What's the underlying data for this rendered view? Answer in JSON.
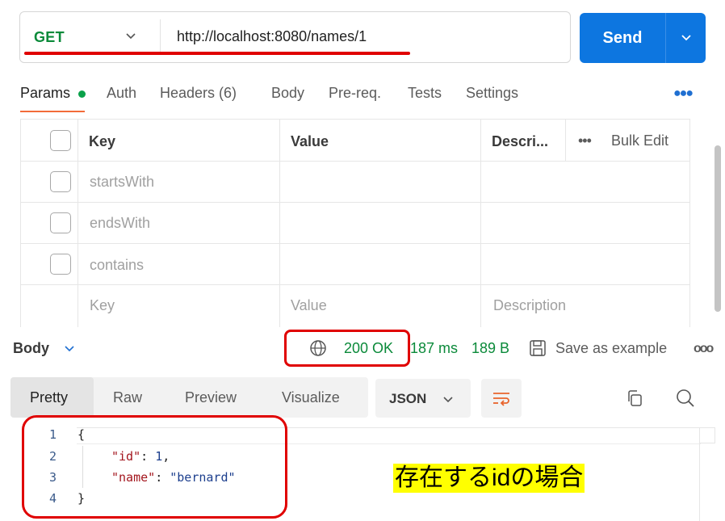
{
  "request": {
    "method": "GET",
    "url": "http://localhost:8080/names/1",
    "send_label": "Send"
  },
  "tabs": [
    {
      "label": "Params",
      "active": true
    },
    {
      "label": "Auth"
    },
    {
      "label": "Headers (6)"
    },
    {
      "label": "Body"
    },
    {
      "label": "Pre-req."
    },
    {
      "label": "Tests"
    },
    {
      "label": "Settings"
    }
  ],
  "params": {
    "headers": {
      "key": "Key",
      "value": "Value",
      "description": "Descri...",
      "bulk_edit": "Bulk Edit"
    },
    "rows": [
      {
        "key": "startsWith",
        "value": "",
        "description": ""
      },
      {
        "key": "endsWith",
        "value": "",
        "description": ""
      },
      {
        "key": "contains",
        "value": "",
        "description": ""
      }
    ],
    "placeholder": {
      "key": "Key",
      "value": "Value",
      "description": "Description"
    }
  },
  "response": {
    "body_label": "Body",
    "status": "200 OK",
    "time": "187 ms",
    "size": "189 B",
    "save_label": "Save as example",
    "view_tabs": [
      "Pretty",
      "Raw",
      "Preview",
      "Visualize"
    ],
    "format": "JSON",
    "lines": [
      "1",
      "2",
      "3",
      "4"
    ],
    "code": {
      "open": "{",
      "id_key": "\"id\"",
      "id_value": "1",
      "name_key": "\"name\"",
      "name_value": "\"bernard\"",
      "close": "}"
    }
  },
  "annotation": "存在するidの場合",
  "colors": {
    "accent": "#0d76e0",
    "success": "#0b8a3a",
    "highlight": "#e00000",
    "note_bg": "#ffff00"
  }
}
